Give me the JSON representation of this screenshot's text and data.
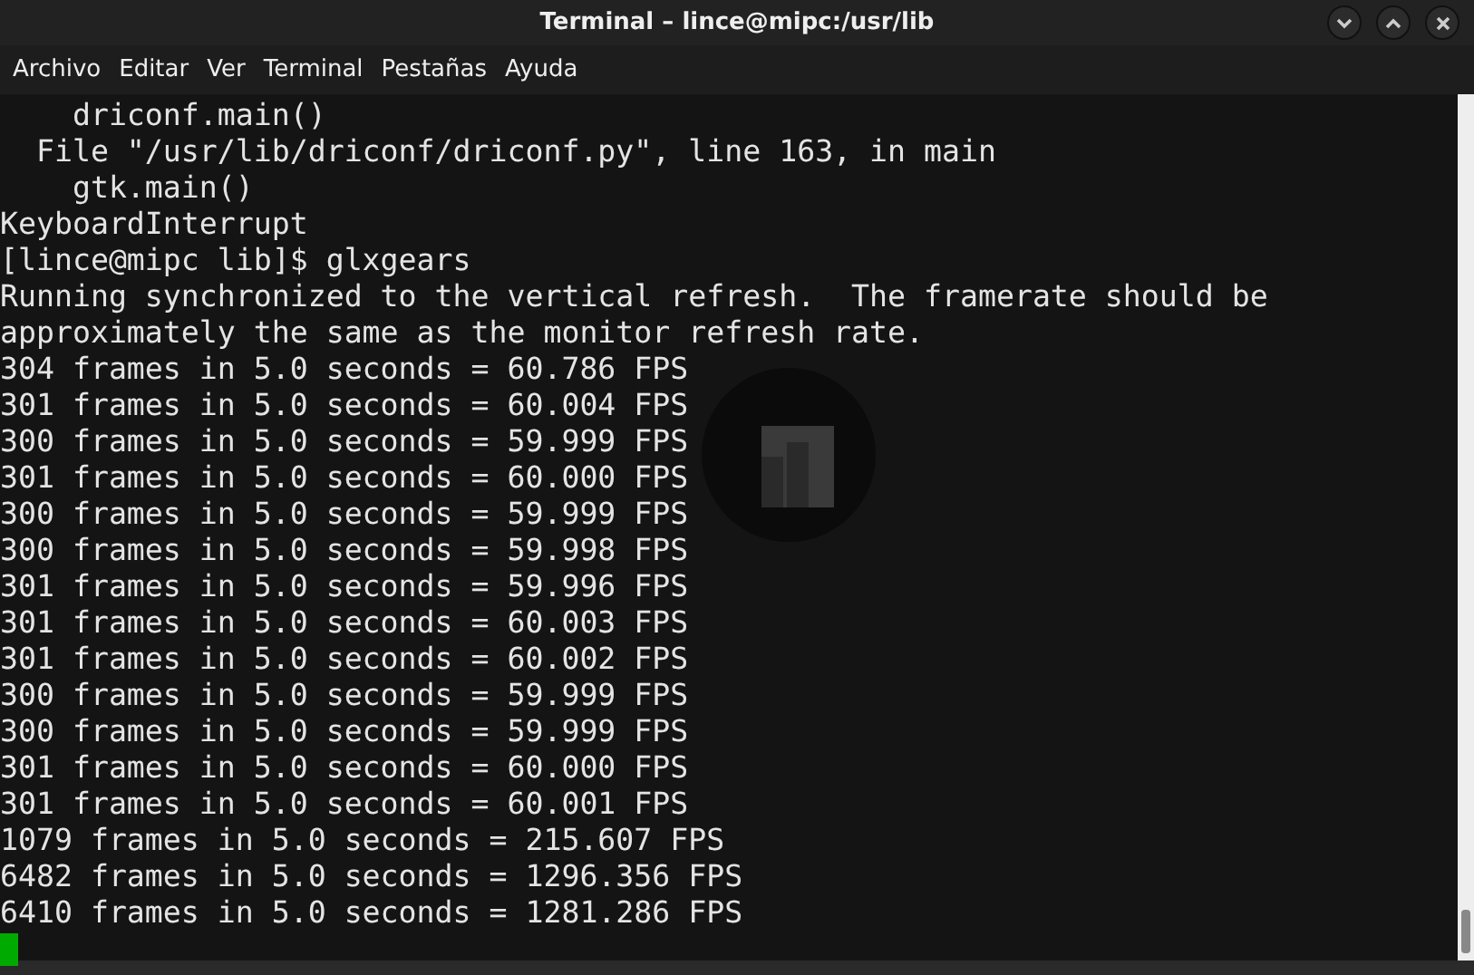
{
  "window": {
    "title": "Terminal – lince@mipc:/usr/lib"
  },
  "menu": [
    "Archivo",
    "Editar",
    "Ver",
    "Terminal",
    "Pestañas",
    "Ayuda"
  ],
  "terminal": {
    "lines": [
      "    driconf.main()",
      "  File \"/usr/lib/driconf/driconf.py\", line 163, in main",
      "    gtk.main()",
      "KeyboardInterrupt",
      "[lince@mipc lib]$ glxgears",
      "Running synchronized to the vertical refresh.  The framerate should be",
      "approximately the same as the monitor refresh rate.",
      "304 frames in 5.0 seconds = 60.786 FPS",
      "301 frames in 5.0 seconds = 60.004 FPS",
      "300 frames in 5.0 seconds = 59.999 FPS",
      "301 frames in 5.0 seconds = 60.000 FPS",
      "300 frames in 5.0 seconds = 59.999 FPS",
      "300 frames in 5.0 seconds = 59.998 FPS",
      "301 frames in 5.0 seconds = 59.996 FPS",
      "301 frames in 5.0 seconds = 60.003 FPS",
      "301 frames in 5.0 seconds = 60.002 FPS",
      "300 frames in 5.0 seconds = 59.999 FPS",
      "300 frames in 5.0 seconds = 59.999 FPS",
      "301 frames in 5.0 seconds = 60.000 FPS",
      "301 frames in 5.0 seconds = 60.001 FPS",
      "1079 frames in 5.0 seconds = 215.607 FPS",
      "6482 frames in 5.0 seconds = 1296.356 FPS",
      "6410 frames in 5.0 seconds = 1281.286 FPS"
    ]
  }
}
